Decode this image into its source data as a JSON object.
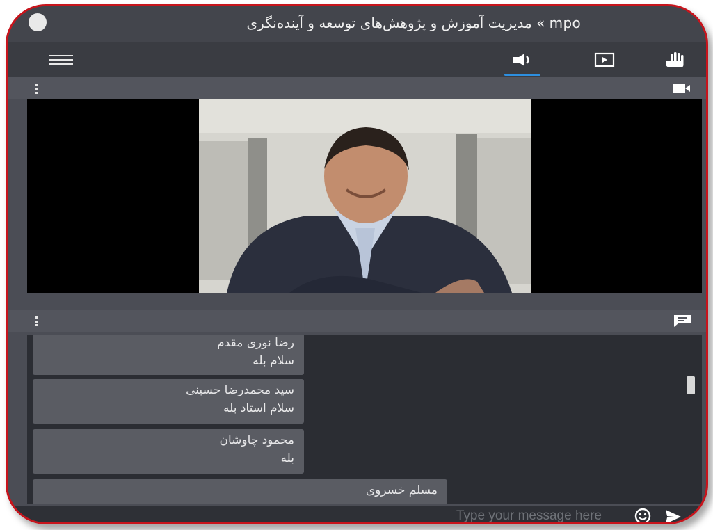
{
  "window": {
    "title": "مدیریت آموزش و پژوهش‌های توسعه و آینده‌نگری « mpo"
  },
  "toolbar": {
    "menu_icon": "hamburger-icon",
    "icons": [
      "speaker-icon",
      "screen-share-icon",
      "raise-hand-icon"
    ],
    "active_icon": "speaker-icon",
    "accent_color": "#2d8fe0"
  },
  "video_panel": {
    "menu_icon": "vertical-dots-icon",
    "panel_icon": "video-camera-icon"
  },
  "chat_panel": {
    "menu_icon": "vertical-dots-icon",
    "panel_icon": "chat-icon",
    "messages": [
      {
        "name": "رضا نوری مقدم",
        "text": "سلام بله"
      },
      {
        "name": "سید محمدرضا حسینی",
        "text": "سلام استاد بله"
      },
      {
        "name": "محمود چاوشان",
        "text": "بله"
      },
      {
        "name": "مسلم خسروی",
        "text": ""
      }
    ]
  },
  "input": {
    "placeholder": "Type your message here",
    "emoji_icon": "smiley-icon",
    "send_icon": "send-icon"
  },
  "colors": {
    "frame_border": "#c8141c"
  }
}
